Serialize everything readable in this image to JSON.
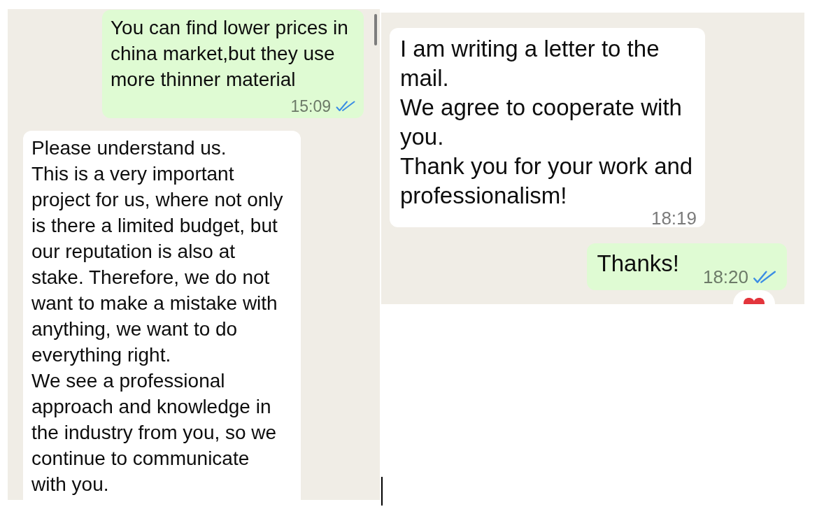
{
  "chats": [
    {
      "messages": [
        {
          "kind": "sent",
          "text": "You can find lower prices in china market,but they use more thinner material",
          "time": "15:09",
          "read": true
        },
        {
          "kind": "received",
          "text": "Please understand us.\nThis is a very important project for us, where not only is there a limited budget, but our reputation is also at stake. Therefore, we do not want to make a mistake with anything, we want to do everything right.\nWe see a professional approach and knowledge in the industry from you, so we continue to communicate with you."
        }
      ]
    },
    {
      "messages": [
        {
          "kind": "received",
          "text": "I am writing a letter to the mail.\nWe agree to cooperate with you.\nThank you for your work and professionalism!",
          "time": "18:19"
        },
        {
          "kind": "sent",
          "text": "Thanks!",
          "time": "18:20",
          "read": true,
          "reacted": true
        }
      ]
    }
  ]
}
